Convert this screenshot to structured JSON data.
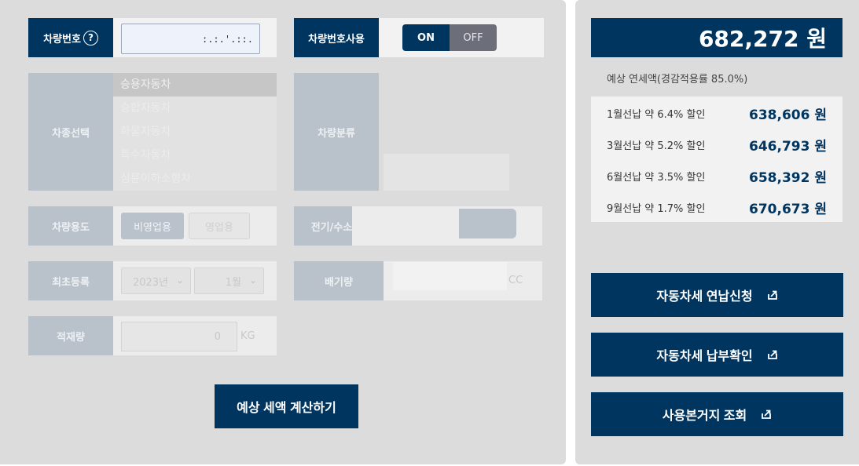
{
  "vehicle_number": {
    "label": "차량번호",
    "help_icon": "?",
    "value": ":.:.'.::."
  },
  "plate_use": {
    "label": "차량번호사용",
    "on_label": "ON",
    "off_label": "OFF",
    "state": "ON"
  },
  "vehicle_type": {
    "label": "차종선택",
    "options": [
      "승용자동차",
      "승합자동차",
      "화물자동차",
      "특수자동차",
      "심륜이하소형차"
    ],
    "selected": "승용자동차"
  },
  "vehicle_class": {
    "label": "차량분류"
  },
  "usage": {
    "label": "차량용도",
    "options": [
      "비영업용",
      "영업용"
    ],
    "selected": "비영업용"
  },
  "fuel": {
    "label": "전기/수소차",
    "option_a": "",
    "option_b": ""
  },
  "first_registration": {
    "label": "최초등록",
    "year": "2023년",
    "month": "1월"
  },
  "displacement": {
    "label": "배기량",
    "value": "",
    "unit": "CC"
  },
  "load": {
    "label": "적재량",
    "value": "0",
    "unit": "KG"
  },
  "calc_button": "예상 세액 계산하기",
  "result": {
    "total": "682,272 원",
    "note": "예상 연세액(경감적용률 85.0%)",
    "discounts": [
      {
        "label": "1월선납 약 6.4% 할인",
        "amount": "638,606 원"
      },
      {
        "label": "3월선납 약 5.2% 할인",
        "amount": "646,793 원"
      },
      {
        "label": "6월선납 약 3.5% 할인",
        "amount": "658,392 원"
      },
      {
        "label": "9월선납 약 1.7% 할인",
        "amount": "670,673 원"
      }
    ]
  },
  "actions": [
    {
      "label": "자동차세 연납신청",
      "icon": "external-link-icon"
    },
    {
      "label": "자동차세 납부확인",
      "icon": "external-link-icon"
    },
    {
      "label": "사용본거지 조회",
      "icon": "external-link-icon"
    }
  ],
  "colors": {
    "navy": "#003560",
    "panel": "#dcdcdc",
    "dim_label": "#b9c2cb"
  }
}
